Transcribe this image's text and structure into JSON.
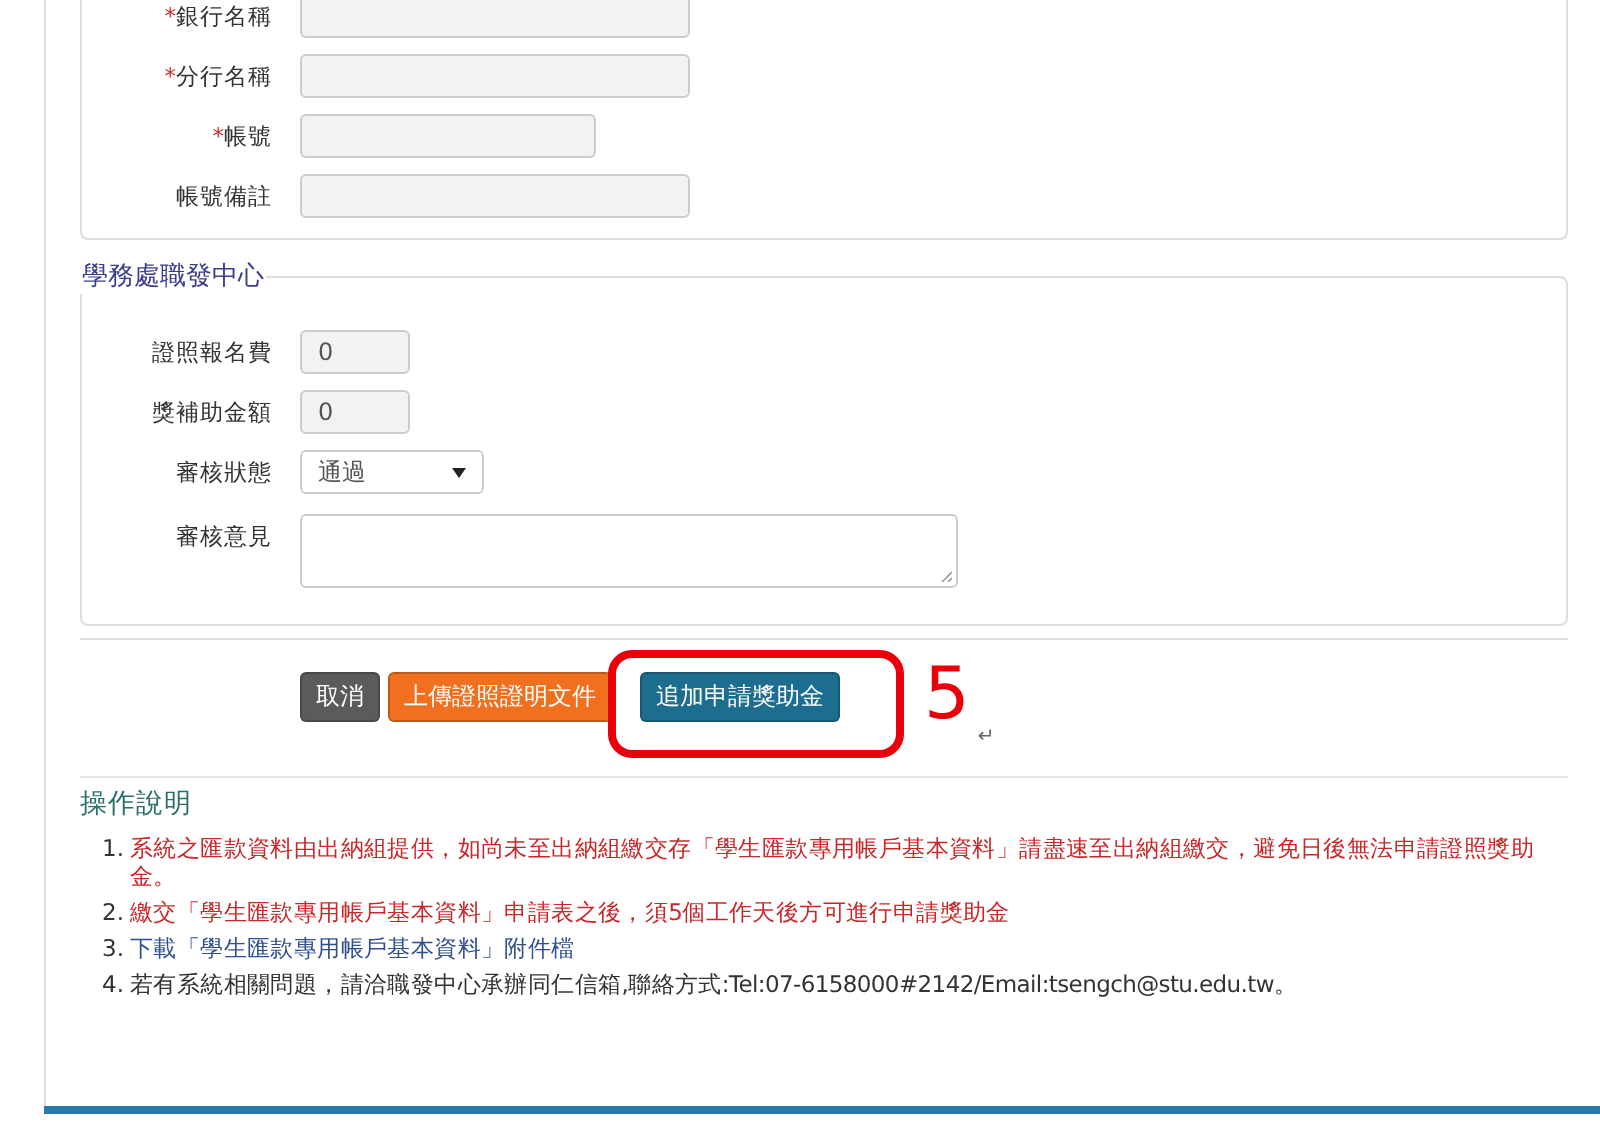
{
  "bank_section": {
    "fields": [
      {
        "label": "銀行名稱",
        "required_mark": "*",
        "kind": "wide",
        "disabled": true
      },
      {
        "label": "分行名稱",
        "required_mark": "*",
        "kind": "wide",
        "disabled": true
      },
      {
        "label": "帳號",
        "required_mark": "*",
        "kind": "medium",
        "disabled": true
      },
      {
        "label": "帳號備註",
        "kind": "wide",
        "disabled": true
      }
    ]
  },
  "career_section": {
    "legend": "學務處職發中心",
    "fields": [
      {
        "label": "證照報名費",
        "kind": "narrow",
        "disabled": true,
        "value": "0"
      },
      {
        "label": "獎補助金額",
        "kind": "narrow",
        "disabled": true,
        "value": "0"
      },
      {
        "label": "審核狀態",
        "kind": "select",
        "disabled": false,
        "value": "通過"
      },
      {
        "label": "審核意見",
        "kind": "textarea",
        "disabled": false
      }
    ]
  },
  "buttons": [
    {
      "label": "取消",
      "kind": "cancel",
      "highlighted": false
    },
    {
      "label": "上傳證照證明文件",
      "kind": "upload",
      "highlighted": false
    },
    {
      "label": "追加申請獎助金",
      "kind": "submit",
      "highlighted": true
    }
  ],
  "annotation": {
    "label": "5",
    "mark": "↵"
  },
  "instructions": {
    "title": "操作說明",
    "items": [
      {
        "number": "1.",
        "text": "系統之匯款資料由出納組提供，如尚未至出納組繳交存「學生匯款專用帳戶基本資料」請盡速至出納組繳交，避免日後無法申請證照獎助金。",
        "kind": "warning"
      },
      {
        "number": "2.",
        "text": "繳交「學生匯款專用帳戶基本資料」申請表之後，須5個工作天後方可進行申請獎助金",
        "kind": "warning"
      },
      {
        "number": "3.",
        "text": "下載「學生匯款專用帳戶基本資料」附件檔",
        "kind": "link"
      },
      {
        "number": "4.",
        "text": "若有系統相關問題，請洽職發中心承辦同仁信箱,聯絡方式:Tel:07-6158000#2142/Email:tsengch@stu.edu.tw。",
        "kind": "plain"
      }
    ]
  }
}
